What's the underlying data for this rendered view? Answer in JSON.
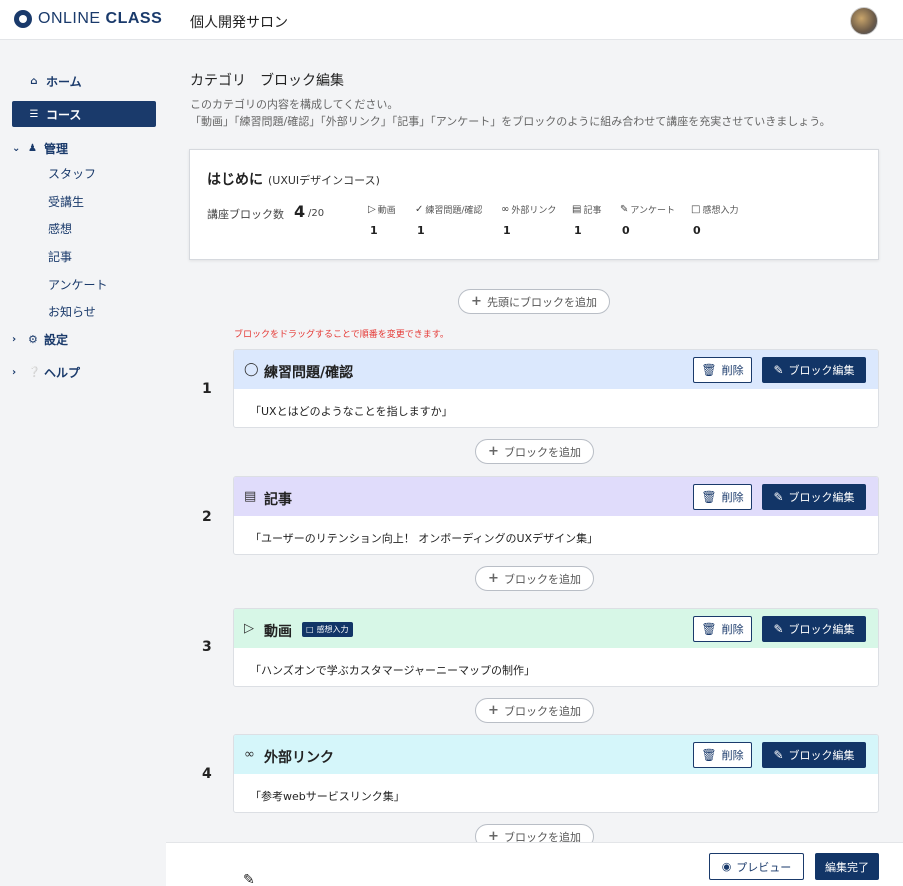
{
  "header": {
    "logo_light": "ONLINE ",
    "logo_bold": "CLASS",
    "app_title": "個人開発サロン"
  },
  "sidebar": {
    "home": "ホーム",
    "course": "コース",
    "manage": "管理",
    "manage_items": [
      "スタッフ",
      "受講生",
      "感想",
      "記事",
      "アンケート",
      "お知らせ"
    ],
    "settings": "設定",
    "help": "ヘルプ"
  },
  "page": {
    "title": "カテゴリ　ブロック編集",
    "desc1": "このカテゴリの内容を構成してください。",
    "desc2": "「動画」「練習問題/確認」「外部リンク」「記事」「アンケート」をブロックのように組み合わせて講座を充実させていきましょう。"
  },
  "summary": {
    "title": "はじめに",
    "course": "(UXUIデザインコース)",
    "count_label": "講座ブロック数",
    "count": "4",
    "total": "/20",
    "stats": [
      {
        "label": "動画",
        "value": "1",
        "icon": "play-circle-icon"
      },
      {
        "label": "練習問題/確認",
        "value": "1",
        "icon": "check-circle-icon"
      },
      {
        "label": "外部リンク",
        "value": "1",
        "icon": "link-icon"
      },
      {
        "label": "記事",
        "value": "1",
        "icon": "article-icon"
      },
      {
        "label": "アンケート",
        "value": "0",
        "icon": "pencil-icon"
      },
      {
        "label": "感想入力",
        "value": "0",
        "icon": "comment-icon"
      }
    ]
  },
  "add_first_label": "先頭にブロックを追加",
  "add_label": "ブロックを追加",
  "drag_hint": "ブロックをドラッグすることで順番を変更できます。",
  "buttons": {
    "delete": "削除",
    "edit": "ブロック編集",
    "preview": "プレビュー",
    "done": "編集完了"
  },
  "blocks": [
    {
      "num": "1",
      "title": "練習問題/確認",
      "icon": "check-circle-icon",
      "color": "#dbe8fd",
      "body": "「UXとはどのようなことを指しますか」"
    },
    {
      "num": "2",
      "title": "記事",
      "icon": "article-icon",
      "color": "#e0dcfb",
      "body": "「ユーザーのリテンション向上！ オンボーディングのUXデザイン集」"
    },
    {
      "num": "3",
      "title": "動画",
      "icon": "play-circle-icon",
      "color": "#d7f7e7",
      "badge": "感想入力",
      "body": "「ハンズオンで学ぶカスタマージャーニーマップの制作」"
    },
    {
      "num": "4",
      "title": "外部リンク",
      "icon": "link-icon",
      "color": "#d5f6fa",
      "body": "「参考webサービスリンク集」"
    }
  ]
}
